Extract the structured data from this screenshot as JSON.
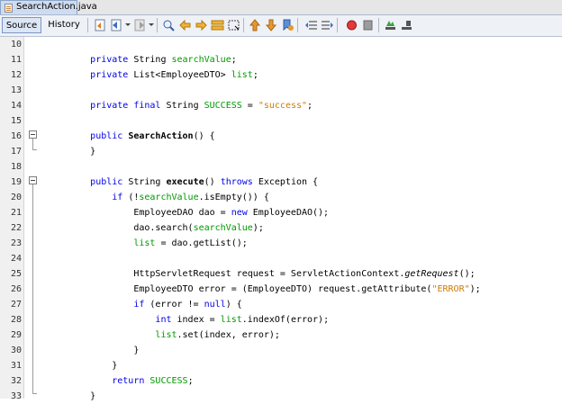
{
  "file_tab": {
    "name": "SearchAction.java"
  },
  "toolbar": {
    "source_label": "Source",
    "history_label": "History"
  },
  "editor": {
    "lines": [
      {
        "n": "10",
        "tokens": []
      },
      {
        "n": "11",
        "tokens": [
          {
            "t": "        "
          },
          {
            "t": "private",
            "c": "kw"
          },
          {
            "t": " String "
          },
          {
            "t": "searchValue",
            "c": "fld"
          },
          {
            "t": ";"
          }
        ]
      },
      {
        "n": "12",
        "tokens": [
          {
            "t": "        "
          },
          {
            "t": "private",
            "c": "kw"
          },
          {
            "t": " List<EmployeeDTO> "
          },
          {
            "t": "list",
            "c": "fld"
          },
          {
            "t": ";"
          }
        ]
      },
      {
        "n": "13",
        "tokens": []
      },
      {
        "n": "14",
        "tokens": [
          {
            "t": "        "
          },
          {
            "t": "private final",
            "c": "kw"
          },
          {
            "t": " String "
          },
          {
            "t": "SUCCESS",
            "c": "fld"
          },
          {
            "t": " = "
          },
          {
            "t": "\"success\"",
            "c": "str"
          },
          {
            "t": ";"
          }
        ]
      },
      {
        "n": "15",
        "tokens": []
      },
      {
        "n": "16",
        "tokens": [
          {
            "t": "        "
          },
          {
            "t": "public",
            "c": "kw"
          },
          {
            "t": " "
          },
          {
            "t": "SearchAction",
            "c": "bold"
          },
          {
            "t": "() {"
          }
        ]
      },
      {
        "n": "17",
        "tokens": [
          {
            "t": "        }"
          }
        ]
      },
      {
        "n": "18",
        "tokens": []
      },
      {
        "n": "19",
        "tokens": [
          {
            "t": "        "
          },
          {
            "t": "public",
            "c": "kw"
          },
          {
            "t": " String "
          },
          {
            "t": "execute",
            "c": "bold"
          },
          {
            "t": "() "
          },
          {
            "t": "throws",
            "c": "kw"
          },
          {
            "t": " Exception {"
          }
        ]
      },
      {
        "n": "20",
        "tokens": [
          {
            "t": "            "
          },
          {
            "t": "if",
            "c": "kw"
          },
          {
            "t": " (!"
          },
          {
            "t": "searchValue",
            "c": "fld"
          },
          {
            "t": ".isEmpty()) {"
          }
        ]
      },
      {
        "n": "21",
        "tokens": [
          {
            "t": "                EmployeeDAO dao = "
          },
          {
            "t": "new",
            "c": "kw"
          },
          {
            "t": " EmployeeDAO();"
          }
        ]
      },
      {
        "n": "22",
        "tokens": [
          {
            "t": "                dao.search("
          },
          {
            "t": "searchValue",
            "c": "fld"
          },
          {
            "t": ");"
          }
        ]
      },
      {
        "n": "23",
        "tokens": [
          {
            "t": "                "
          },
          {
            "t": "list",
            "c": "fld"
          },
          {
            "t": " = dao.getList();"
          }
        ]
      },
      {
        "n": "24",
        "tokens": []
      },
      {
        "n": "25",
        "tokens": [
          {
            "t": "                HttpServletRequest request = ServletActionContext."
          },
          {
            "t": "getRequest",
            "c": "ital"
          },
          {
            "t": "();"
          }
        ]
      },
      {
        "n": "26",
        "tokens": [
          {
            "t": "                EmployeeDTO error = (EmployeeDTO) request.getAttribute("
          },
          {
            "t": "\"ERROR\"",
            "c": "str"
          },
          {
            "t": ");"
          }
        ]
      },
      {
        "n": "27",
        "tokens": [
          {
            "t": "                "
          },
          {
            "t": "if",
            "c": "kw"
          },
          {
            "t": " (error != "
          },
          {
            "t": "null",
            "c": "kw"
          },
          {
            "t": ") {"
          }
        ]
      },
      {
        "n": "28",
        "tokens": [
          {
            "t": "                    "
          },
          {
            "t": "int",
            "c": "kw"
          },
          {
            "t": " index = "
          },
          {
            "t": "list",
            "c": "fld"
          },
          {
            "t": ".indexOf(error);"
          }
        ]
      },
      {
        "n": "29",
        "tokens": [
          {
            "t": "                    "
          },
          {
            "t": "list",
            "c": "fld"
          },
          {
            "t": ".set(index, error);"
          }
        ]
      },
      {
        "n": "30",
        "tokens": [
          {
            "t": "                }"
          }
        ]
      },
      {
        "n": "31",
        "tokens": [
          {
            "t": "            }"
          }
        ]
      },
      {
        "n": "32",
        "tokens": [
          {
            "t": "            "
          },
          {
            "t": "return",
            "c": "kw"
          },
          {
            "t": " "
          },
          {
            "t": "SUCCESS",
            "c": "fld"
          },
          {
            "t": ";"
          }
        ]
      },
      {
        "n": "33",
        "tokens": [
          {
            "t": "        }"
          }
        ]
      }
    ]
  }
}
